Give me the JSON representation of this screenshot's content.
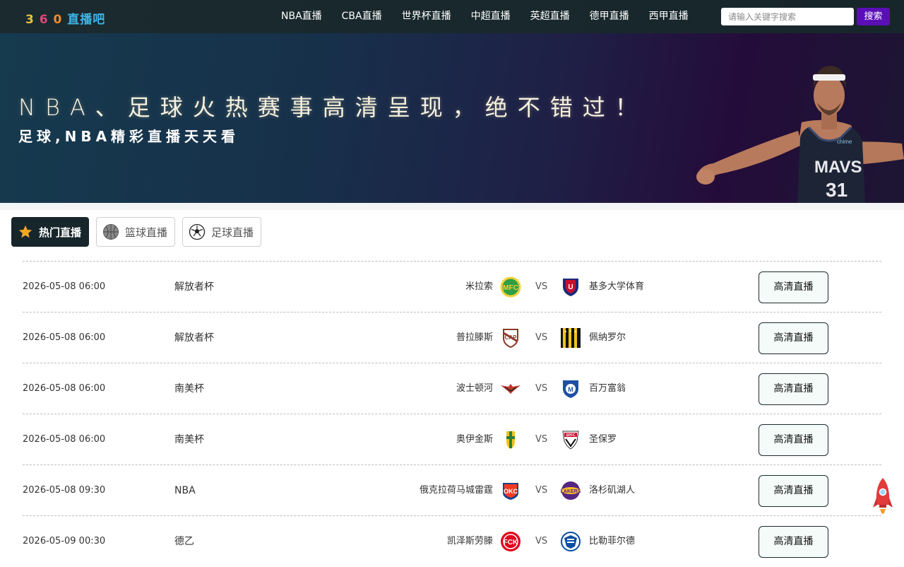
{
  "site": {
    "logo_digits": [
      "3",
      "6",
      "0"
    ],
    "logo_text": "直播吧"
  },
  "nav": {
    "items": [
      "NBA直播",
      "CBA直播",
      "世界杯直播",
      "中超直播",
      "英超直播",
      "德甲直播",
      "西甲直播"
    ]
  },
  "search": {
    "placeholder": "请输入关键字搜索",
    "button_label": "搜索"
  },
  "banner": {
    "title": "NBA、足球火热赛事高清呈现，绝不错过！",
    "subtitle": "足球,NBA精彩直播天天看",
    "player_jersey": {
      "team": "MAVS",
      "number": "31",
      "sponsor": "chime"
    }
  },
  "tabs": [
    {
      "label": "热门直播",
      "icon": "star-icon",
      "active": true
    },
    {
      "label": "篮球直播",
      "icon": "basketball-icon",
      "active": false
    },
    {
      "label": "足球直播",
      "icon": "soccer-ball-icon",
      "active": false
    }
  ],
  "matches": [
    {
      "time": "2026-05-08 06:00",
      "league": "解放者杯",
      "home": "米拉索",
      "vs": "VS",
      "away": "基多大学体育",
      "button": "高清直播"
    },
    {
      "time": "2026-05-08 06:00",
      "league": "解放者杯",
      "home": "普拉滕斯",
      "vs": "VS",
      "away": "佩纳罗尔",
      "button": "高清直播"
    },
    {
      "time": "2026-05-08 06:00",
      "league": "南美杯",
      "home": "波士顿河",
      "vs": "VS",
      "away": "百万富翁",
      "button": "高清直播"
    },
    {
      "time": "2026-05-08 06:00",
      "league": "南美杯",
      "home": "奥伊金斯",
      "vs": "VS",
      "away": "圣保罗",
      "button": "高清直播"
    },
    {
      "time": "2026-05-08 09:30",
      "league": "NBA",
      "home": "俄克拉荷马城雷霆",
      "vs": "VS",
      "away": "洛杉矶湖人",
      "button": "高清直播"
    },
    {
      "time": "2026-05-09 00:30",
      "league": "德乙",
      "home": "凯泽斯劳滕",
      "vs": "VS",
      "away": "比勒菲尔德",
      "button": "高清直播"
    }
  ],
  "colors": {
    "topbar": "#17262b",
    "search_button": "#5a0fb5",
    "active_tab": "#17262b"
  }
}
